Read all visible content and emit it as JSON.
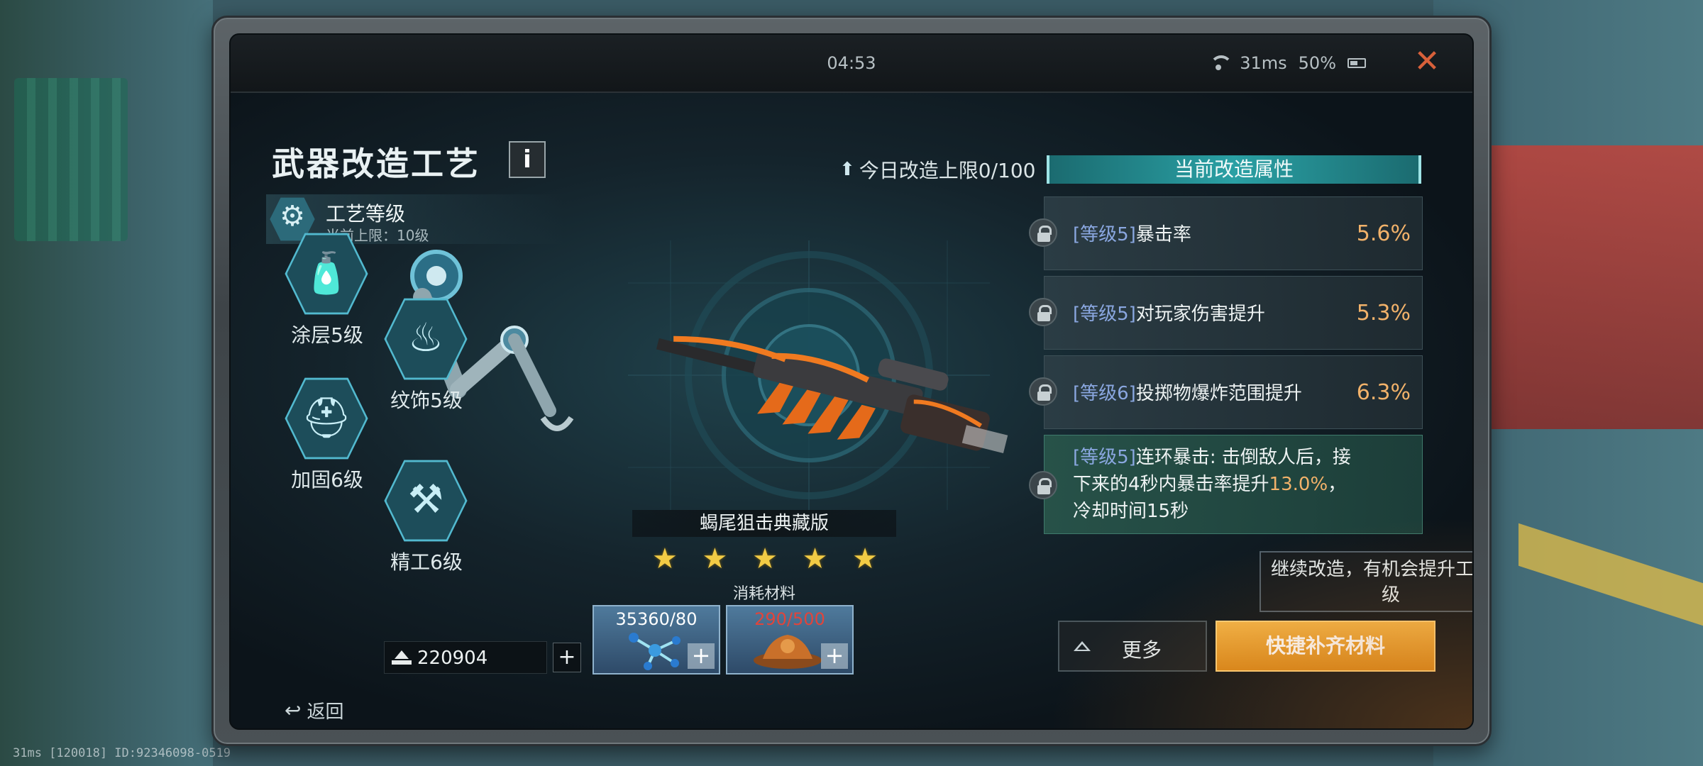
{
  "status": {
    "clock": "04:53",
    "ping": "31ms",
    "battery": "50%"
  },
  "bottom_status": "31ms  [120018] ID:92346098-0519",
  "left": {
    "title": "武器改造工艺",
    "info_label": "i",
    "craft": {
      "name": "工艺等级",
      "cap": "当前上限：10级"
    },
    "mods": [
      {
        "label": "涂层5级",
        "icon": "spray-can-icon"
      },
      {
        "label": "纹饰5级",
        "icon": "flame-icon"
      },
      {
        "label": "加固6级",
        "icon": "welding-mask-icon"
      },
      {
        "label": "精工6级",
        "icon": "drill-icon"
      }
    ],
    "currency": "220904",
    "plus_label": "+",
    "back_label": "返回"
  },
  "center": {
    "daily_limit": "今日改造上限0/100",
    "weapon_name": "蝎尾狙击典藏版",
    "stars": 5,
    "materials_label": "消耗材料",
    "materials": [
      {
        "count": "35360/80",
        "color": "#ffffff",
        "icon": "molecule-icon"
      },
      {
        "count": "290/500",
        "color": "#e2443a",
        "icon": "mechanical-part-icon"
      }
    ]
  },
  "right": {
    "header": "当前改造属性",
    "attributes": [
      {
        "level": "[等级5]",
        "name": "暴击率",
        "value": "5.6%"
      },
      {
        "level": "[等级5]",
        "name": "对玩家伤害提升",
        "value": "5.3%"
      },
      {
        "level": "[等级6]",
        "name": "投掷物爆炸范围提升",
        "value": "6.3%"
      }
    ],
    "special": {
      "level": "[等级5]",
      "line1": "连环暴击: 击倒敌人后，接",
      "line2_pre": "下来的4秒内暴击率提升",
      "line2_val": "13.0%",
      "line2_post": "，",
      "line3": "冷却时间15秒"
    },
    "tooltip": "继续改造，有机会提升工艺等级",
    "more_label": "更多",
    "quick_label": "快捷补齐材料"
  }
}
